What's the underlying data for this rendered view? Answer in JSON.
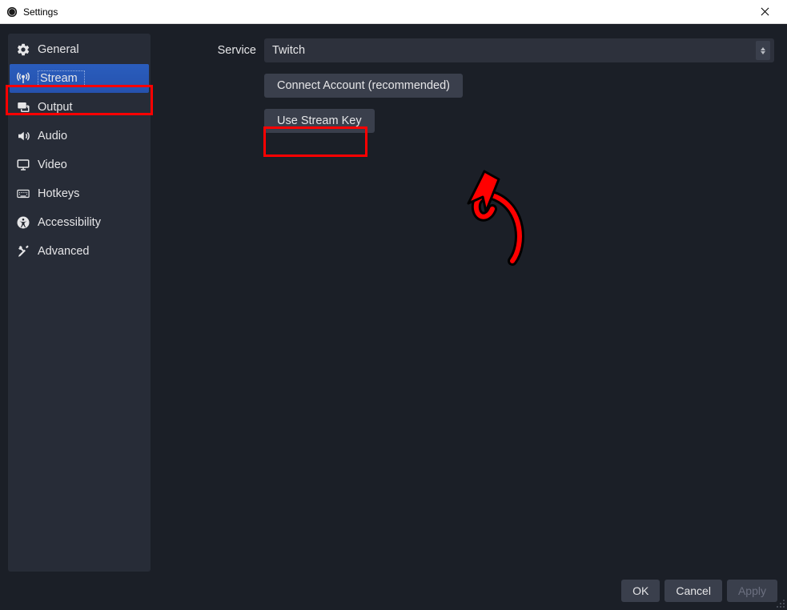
{
  "window": {
    "title": "Settings"
  },
  "sidebar": {
    "items": [
      {
        "id": "general",
        "label": "General",
        "icon": "gear-icon",
        "selected": false
      },
      {
        "id": "stream",
        "label": "Stream",
        "icon": "antenna-icon",
        "selected": true
      },
      {
        "id": "output",
        "label": "Output",
        "icon": "screen-share-icon",
        "selected": false
      },
      {
        "id": "audio",
        "label": "Audio",
        "icon": "speaker-icon",
        "selected": false
      },
      {
        "id": "video",
        "label": "Video",
        "icon": "display-icon",
        "selected": false
      },
      {
        "id": "hotkeys",
        "label": "Hotkeys",
        "icon": "keyboard-icon",
        "selected": false
      },
      {
        "id": "accessibility",
        "label": "Accessibility",
        "icon": "accessibility-icon",
        "selected": false
      },
      {
        "id": "advanced",
        "label": "Advanced",
        "icon": "tools-icon",
        "selected": false
      }
    ]
  },
  "main": {
    "service_label": "Service",
    "service_value": "Twitch",
    "connect_account_label": "Connect Account (recommended)",
    "use_stream_key_label": "Use Stream Key"
  },
  "footer": {
    "ok_label": "OK",
    "cancel_label": "Cancel",
    "apply_label": "Apply"
  },
  "annotations": {
    "stream_highlight": true,
    "stream_key_highlight": true,
    "arrow": true
  }
}
